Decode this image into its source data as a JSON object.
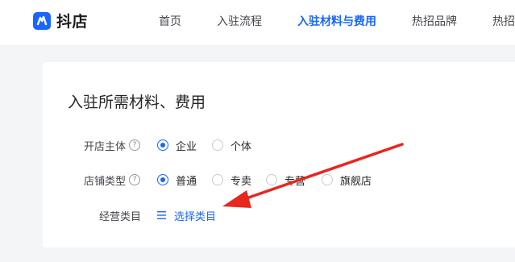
{
  "brand": {
    "name": "抖店",
    "color": "#1966ff"
  },
  "nav": {
    "items": [
      {
        "label": "首页",
        "active": false
      },
      {
        "label": "入驻流程",
        "active": false
      },
      {
        "label": "入驻材料与费用",
        "active": true
      },
      {
        "label": "热招品牌",
        "active": false
      },
      {
        "label": "热招",
        "active": false
      }
    ]
  },
  "card": {
    "title": "入驻所需材料、费用",
    "entity": {
      "label": "开店主体",
      "help": "?",
      "options": [
        {
          "label": "企业",
          "checked": true
        },
        {
          "label": "个体",
          "checked": false
        }
      ]
    },
    "store_type": {
      "label": "店铺类型",
      "help": "?",
      "options": [
        {
          "label": "普通",
          "checked": true
        },
        {
          "label": "专卖",
          "checked": false
        },
        {
          "label": "专营",
          "checked": false
        },
        {
          "label": "旗舰店",
          "checked": false
        }
      ]
    },
    "category": {
      "label": "经营类目",
      "select_label": "选择类目",
      "icon": "menu-icon"
    }
  },
  "annotation": {
    "icon": "red-arrow-icon",
    "color": "#e8271e"
  }
}
